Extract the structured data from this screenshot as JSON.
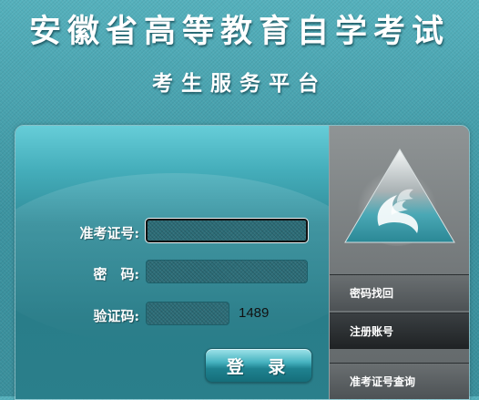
{
  "header": {
    "title": "安徽省高等教育自学考试",
    "subtitle": "考生服务平台"
  },
  "login": {
    "exam_id_label": "准考证号:",
    "password_label": "密　码:",
    "captcha_label": "验证码:",
    "exam_id_value": "",
    "password_value": "",
    "captcha_value": "",
    "captcha_code": "1489",
    "login_button": "登 录"
  },
  "sidebar": {
    "logo": "triangle-flame-logo",
    "items": [
      {
        "label": "密码找回"
      },
      {
        "label": "注册账号"
      },
      {
        "label": "准考证号查询"
      }
    ]
  },
  "colors": {
    "background": "#3f98a5",
    "panel_top": "#66cdd8",
    "sidebar": "#727779"
  }
}
